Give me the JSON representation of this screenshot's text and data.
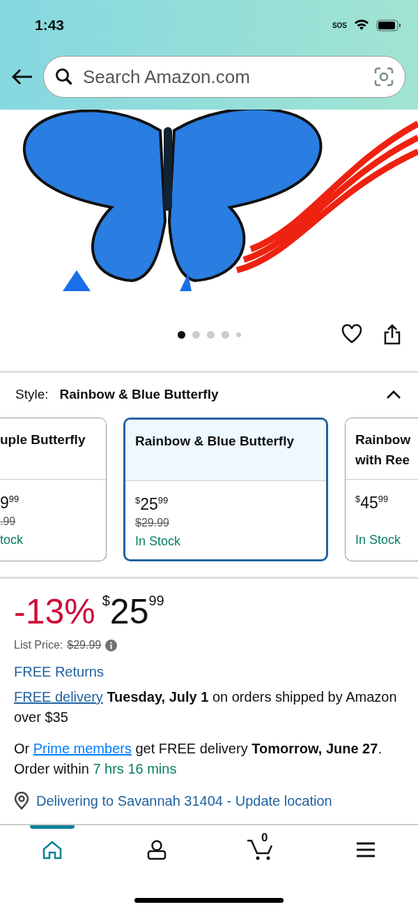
{
  "status_bar": {
    "time": "1:43",
    "carrier": "SOS"
  },
  "search": {
    "placeholder": "Search Amazon.com"
  },
  "gallery": {
    "dots": [
      {
        "selected": true
      },
      {
        "selected": false
      },
      {
        "selected": false
      },
      {
        "selected": false
      },
      {
        "selected": false
      }
    ]
  },
  "style": {
    "label": "Style:",
    "value": "Rainbow & Blue Butterfly",
    "expanded": true
  },
  "style_options": [
    {
      "title": "uple Butterfly",
      "price": {
        "whole": "9",
        "fraction": "99"
      },
      "list_price": ".99",
      "stock": "tock",
      "selected": false
    },
    {
      "title": "Rainbow & Blue Butterfly",
      "price": {
        "symbol": "$",
        "whole": "25",
        "fraction": "99"
      },
      "list_price": "$29.99",
      "stock": "In Stock",
      "selected": true
    },
    {
      "title": "Rainbow with Ree",
      "price": {
        "symbol": "$",
        "whole": "45",
        "fraction": "99"
      },
      "stock": "In Stock",
      "selected": false
    }
  ],
  "price": {
    "discount": "-13%",
    "symbol": "$",
    "whole": "25",
    "fraction": "99",
    "list_label": "List Price:",
    "list_price": "$29.99"
  },
  "returns": "FREE Returns",
  "delivery": [
    {
      "kind": "link",
      "text": "FREE delivery"
    },
    {
      "kind": "bold",
      "text": "Tuesday, July 1"
    },
    {
      "kind": "plain",
      "text": " on orders shipped by Amazon over $35"
    }
  ],
  "prime": [
    {
      "kind": "plain",
      "text": "Or "
    },
    {
      "kind": "prime",
      "text": "Prime members"
    },
    {
      "kind": "plain",
      "text": " get FREE delivery "
    },
    {
      "kind": "bold",
      "text": "Tomorrow, June 27"
    },
    {
      "kind": "plain",
      "text": ". Order within "
    },
    {
      "kind": "green",
      "text": "7 hrs 16 mins"
    }
  ],
  "location": "Delivering to Savannah 31404 - Update location",
  "nav": [
    {
      "kind": "home",
      "selected": true
    },
    {
      "kind": "account",
      "selected": false
    },
    {
      "kind": "cart",
      "selected": false,
      "count": "0"
    },
    {
      "kind": "menu",
      "selected": false
    }
  ]
}
